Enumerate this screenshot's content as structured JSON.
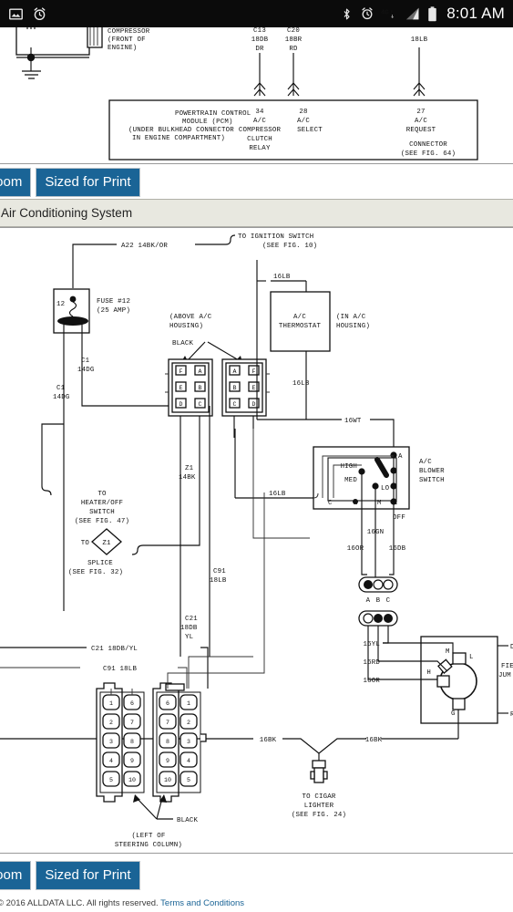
{
  "statusbar": {
    "time": "8:01 AM",
    "left_icons": [
      "image-icon",
      "alarm-clock-icon"
    ],
    "right_icons": [
      "bluetooth-icon",
      "alarm-clock-icon",
      "4g-lte-icon",
      "signal-bars-icon",
      "battery-full-icon"
    ]
  },
  "toolbar": {
    "zoom_label": "Zoom",
    "sized_for_print_label": "Sized for Print"
  },
  "title_bar": {
    "title": "Air Conditioning System"
  },
  "footer": {
    "copyright": "© 2016 ALLDATA LLC. All rights reserved.",
    "terms_link": "Terms and Conditions"
  },
  "diagram_top": {
    "labels": {
      "compressor": [
        "COMPRESSOR",
        "(FRONT OF",
        "ENGINE)"
      ],
      "wire_c13": [
        "C13",
        "18DB",
        "DR"
      ],
      "wire_c20": [
        "C20",
        "18BR",
        "RD"
      ],
      "wire_18lb": "18LB",
      "pcm": [
        "POWERTRAIN CONTROL",
        "MODULE (PCM)",
        "(UNDER BULKHEAD CONNECTOR",
        "IN ENGINE COMPARTMENT)"
      ],
      "pin34": [
        "34",
        "A/C",
        "COMPRESSOR",
        "CLUTCH",
        "RELAY"
      ],
      "pin28": [
        "28",
        "A/C",
        "SELECT"
      ],
      "pin27": [
        "27",
        "A/C",
        "REQUEST"
      ],
      "connector_note": [
        "CONNECTOR",
        "(SEE FIG. 64)"
      ]
    }
  },
  "diagram_main": {
    "labels": {
      "a22": "A22  14BK/OR",
      "to_ignition": [
        "TO IGNITION SWITCH",
        "(SEE FIG. 10)"
      ],
      "fuse_num": "12",
      "fuse": [
        "FUSE #12",
        "(25 AMP)"
      ],
      "c1_14dg_a": [
        "C1",
        "14DG"
      ],
      "c1_14dg_b": [
        "C1",
        "14DG"
      ],
      "above_ac_housing": [
        "(ABOVE A/C",
        "HOUSING)"
      ],
      "black_1": "BLACK",
      "ac_thermostat": [
        "A/C",
        "THERMOSTAT"
      ],
      "in_ac_housing": [
        "(IN A/C",
        "HOUSING)"
      ],
      "w16lb_top": "16LB",
      "w16lb_mid": "16LB",
      "w16wt": "16WT",
      "w16lb_left": "16LB",
      "to_heater_off": [
        "TO",
        "HEATER/OFF",
        "SWITCH",
        "(SEE FIG. 47)"
      ],
      "z1_14bk": [
        "Z1",
        "14BK"
      ],
      "to_z1": "TO",
      "z1_diamond": "Z1",
      "splice": [
        "SPLICE",
        "(SEE FIG. 32)"
      ],
      "c91_18lb": [
        "C91",
        "18LB"
      ],
      "c21_18db_yl": [
        "C21",
        "18DB",
        "YL"
      ],
      "blower_switch": [
        "A/C",
        "BLOWER",
        "SWITCH"
      ],
      "sw_high": "HIGH",
      "sw_med": "MED",
      "sw_lo": "LO",
      "sw_off": "OFF",
      "sw_a": "A",
      "sw_c": "C",
      "sw_h": "H",
      "sw_m": "M",
      "sw_l": "L",
      "w16gn": "16GN",
      "w16or": "16OR",
      "w16db": "16DB",
      "conn_abc": [
        "A",
        "B",
        "C"
      ],
      "c21_18db_yl_left": "C21 18DB/YL",
      "c91_18lb_left": "C91 18LB",
      "black_2": "BLACK",
      "left_of_steering": [
        "(LEFT OF",
        "STEERING COLUMN)"
      ],
      "w16yl": "16YL",
      "w16rd": "16RD",
      "w16or_b": "16OR",
      "w16bk_l": "16BK",
      "w16bk_r": "16BK",
      "to_cigar": [
        "TO CIGAR",
        "LIGHTER",
        "(SEE FIG. 24)"
      ],
      "motor_h": "H",
      "motor_m": "M",
      "motor_l": "L",
      "motor_g": "G",
      "field_jumper": [
        "FIE",
        "JUM"
      ],
      "edge_d": "D",
      "edge_r": "R"
    },
    "connector_pins_left": [
      "1",
      "2",
      "3",
      "4",
      "5",
      "6",
      "7",
      "8",
      "9",
      "10"
    ],
    "connector_pins_right": [
      "6",
      "7",
      "8",
      "9",
      "10",
      "1",
      "2",
      "3",
      "4",
      "5"
    ],
    "six_pin_left": [
      "F",
      "A",
      "E",
      "B",
      "D",
      "C"
    ],
    "six_pin_right": [
      "A",
      "F",
      "B",
      "E",
      "C",
      "D"
    ]
  },
  "colors": {
    "button_blue": "#1a6496",
    "title_bar_bg": "#e8e8e0",
    "statusbar_bg": "#0b0b0b",
    "link_blue": "#1a6496"
  }
}
